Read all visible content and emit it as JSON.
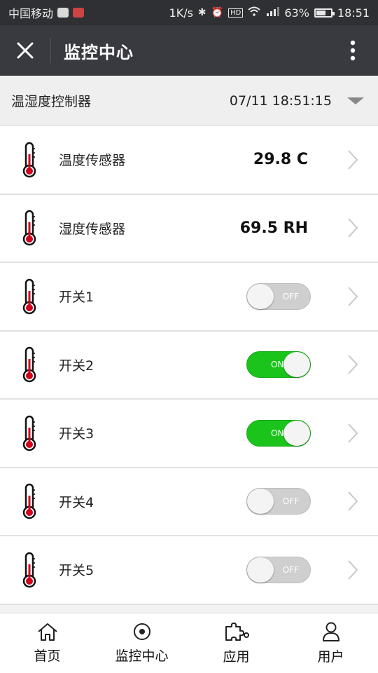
{
  "status_bar": {
    "carrier": "中国移动",
    "speed": "1K/s",
    "battery": "63%",
    "time": "18:51",
    "icons": [
      "bluetooth-icon",
      "alarm-icon",
      "hd-icon",
      "wifi-icon",
      "signal-4g-icon",
      "battery-icon"
    ]
  },
  "titlebar": {
    "title": "监控中心",
    "close_icon": "close-icon",
    "more_icon": "more-vertical-icon"
  },
  "controller": {
    "name": "温湿度控制器",
    "datetime": "07/11 18:51:15",
    "dropdown_icon": "caret-down-icon"
  },
  "rows": [
    {
      "label": "温度传感器",
      "value": "29.8 C",
      "icon": "thermometer-icon"
    },
    {
      "label": "湿度传感器",
      "value": "69.5 RH",
      "icon": "thermometer-icon"
    },
    {
      "label": "开关1",
      "toggle": "OFF",
      "icon": "thermometer-icon"
    },
    {
      "label": "开关2",
      "toggle": "ON",
      "icon": "thermometer-icon"
    },
    {
      "label": "开关3",
      "toggle": "ON",
      "icon": "thermometer-icon"
    },
    {
      "label": "开关4",
      "toggle": "OFF",
      "icon": "thermometer-icon"
    },
    {
      "label": "开关5",
      "toggle": "OFF",
      "icon": "thermometer-icon"
    }
  ],
  "bottom_nav": [
    {
      "label": "首页",
      "icon": "home-icon"
    },
    {
      "label": "监控中心",
      "icon": "monitor-target-icon"
    },
    {
      "label": "应用",
      "icon": "puzzle-icon"
    },
    {
      "label": "用户",
      "icon": "user-icon"
    }
  ],
  "colors": {
    "toggle_on": "#1bc41b",
    "toggle_off": "#cfcfcf",
    "titlebar": "#393a3f",
    "thermometer_bulb": "#d0021b"
  }
}
